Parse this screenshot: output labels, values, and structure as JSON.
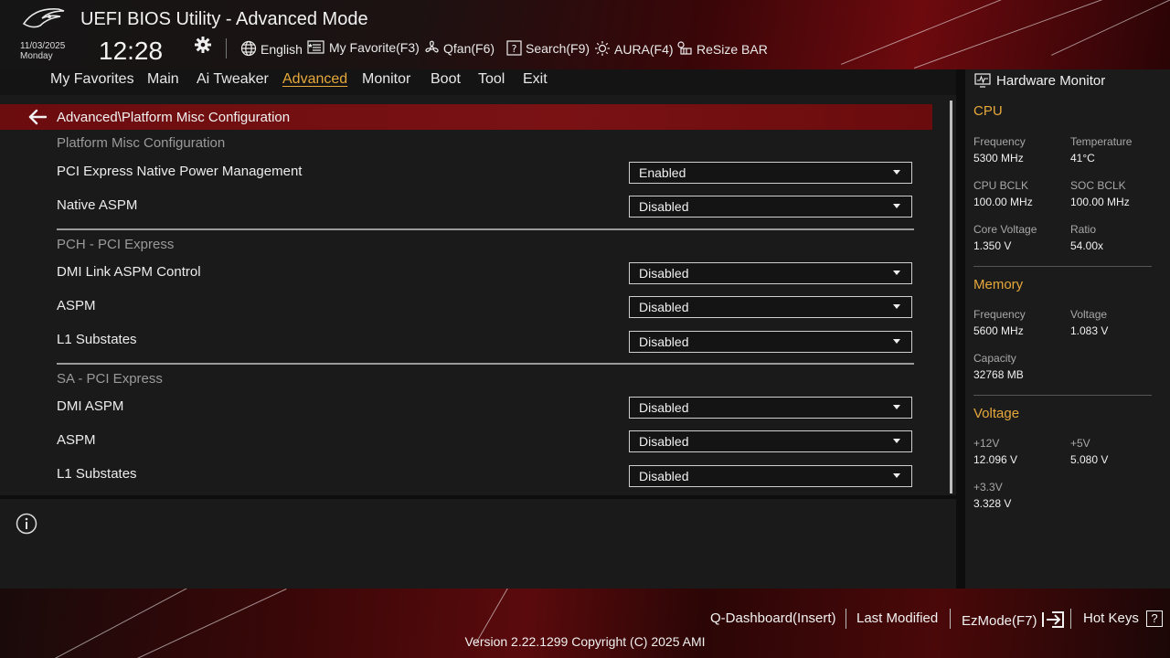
{
  "header": {
    "title": "UEFI BIOS Utility - Advanced Mode",
    "date": "11/03/2025",
    "day": "Monday",
    "time": "12:28",
    "tools": {
      "language": "English",
      "favorite": "My Favorite(F3)",
      "qfan": "Qfan(F6)",
      "search": "Search(F9)",
      "aura": "AURA(F4)",
      "resizebar": "ReSize BAR"
    }
  },
  "menu": {
    "items": [
      "My Favorites",
      "Main",
      "Ai Tweaker",
      "Advanced",
      "Monitor",
      "Boot",
      "Tool",
      "Exit"
    ],
    "active": "Advanced"
  },
  "breadcrumb": "Advanced\\Platform Misc Configuration",
  "sections": {
    "platform": "Platform Misc Configuration",
    "pch": "PCH - PCI Express",
    "sa": "SA - PCI Express"
  },
  "settings": [
    {
      "label": "PCI Express Native Power Management",
      "value": "Enabled"
    },
    {
      "label": "Native ASPM",
      "value": "Disabled"
    },
    {
      "label": "DMI Link ASPM Control",
      "value": "Disabled"
    },
    {
      "label": "ASPM",
      "value": "Disabled"
    },
    {
      "label": "L1 Substates",
      "value": "Disabled"
    },
    {
      "label": "DMI ASPM",
      "value": "Disabled"
    },
    {
      "label": "ASPM",
      "value": "Disabled"
    },
    {
      "label": "L1 Substates",
      "value": "Disabled"
    }
  ],
  "hardware_monitor": {
    "title": "Hardware Monitor",
    "cpu": {
      "heading": "CPU",
      "frequency_label": "Frequency",
      "frequency": "5300 MHz",
      "temperature_label": "Temperature",
      "temperature": "41°C",
      "cpu_bclk_label": "CPU BCLK",
      "cpu_bclk": "100.00 MHz",
      "soc_bclk_label": "SOC BCLK",
      "soc_bclk": "100.00 MHz",
      "core_voltage_label": "Core Voltage",
      "core_voltage": "1.350 V",
      "ratio_label": "Ratio",
      "ratio": "54.00x"
    },
    "memory": {
      "heading": "Memory",
      "frequency_label": "Frequency",
      "frequency": "5600 MHz",
      "voltage_label": "Voltage",
      "voltage": "1.083 V",
      "capacity_label": "Capacity",
      "capacity": "32768 MB"
    },
    "voltage": {
      "heading": "Voltage",
      "v12_label": "+12V",
      "v12": "12.096 V",
      "v5_label": "+5V",
      "v5": "5.080 V",
      "v33_label": "+3.3V",
      "v33": "3.328 V"
    }
  },
  "footer": {
    "qdashboard": "Q-Dashboard(Insert)",
    "last_modified": "Last Modified",
    "ezmode": "EzMode(F7)",
    "hotkeys": "Hot Keys",
    "hotkeys_glyph": "?",
    "version": "Version 2.22.1299 Copyright (C) 2025 AMI"
  },
  "colors": {
    "accent": "#e6a83b",
    "breadcrumb_bg": "#7a1214",
    "panel_bg": "#1a1a1a"
  }
}
